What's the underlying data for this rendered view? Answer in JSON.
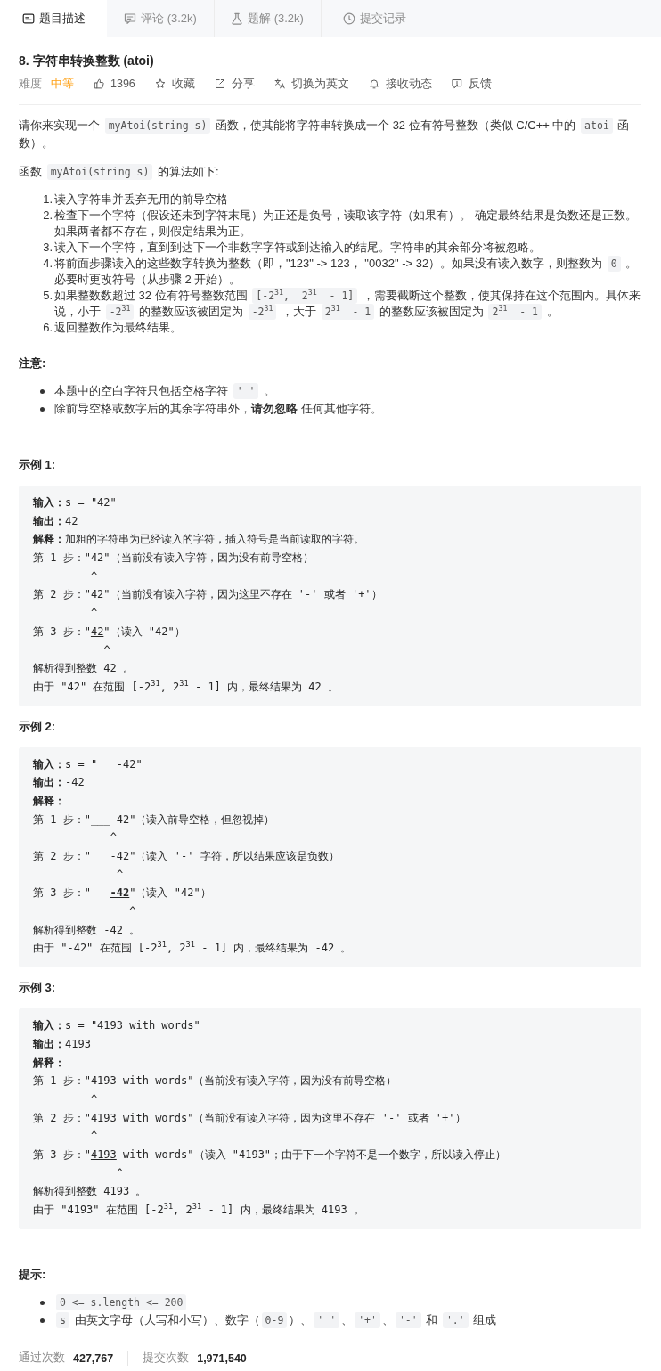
{
  "tabs": [
    {
      "kind": "description",
      "label": "题目描述",
      "selected": true
    },
    {
      "kind": "comments",
      "label": "评论 (3.2k)",
      "selected": false
    },
    {
      "kind": "solutions",
      "label": "题解 (3.2k)",
      "selected": false
    },
    {
      "kind": "submissions",
      "label": "提交记录",
      "selected": false
    }
  ],
  "problem": {
    "title": "8. 字符串转换整数 (atoi)",
    "difficulty": {
      "label": "难度",
      "value": "中等",
      "kind": "medium"
    },
    "actions": [
      {
        "kind": "like",
        "label": "1396"
      },
      {
        "kind": "favorite",
        "label": "收藏"
      },
      {
        "kind": "share",
        "label": "分享"
      },
      {
        "kind": "translate",
        "label": "切换为英文"
      },
      {
        "kind": "subscribe",
        "label": "接收动态"
      },
      {
        "kind": "feedback",
        "label": "反馈"
      }
    ]
  },
  "description": {
    "paragraphs": [
      [
        {
          "kind": "text",
          "text": "请你来实现一个 "
        },
        {
          "kind": "code",
          "text": "myAtoi(string s)"
        },
        {
          "kind": "text",
          "text": " 函数，使其能将字符串转换成一个 32 位有符号整数（类似 C/C++ 中的 "
        },
        {
          "kind": "code",
          "text": "atoi"
        },
        {
          "kind": "text",
          "text": " 函数）。"
        }
      ],
      [
        {
          "kind": "text",
          "text": "函数 "
        },
        {
          "kind": "code",
          "text": "myAtoi(string s)"
        },
        {
          "kind": "text",
          "text": " 的算法如下:"
        }
      ]
    ],
    "steps": [
      {
        "number": "1.",
        "segments": [
          {
            "kind": "text",
            "text": "读入字符串并丢弃无用的前导空格"
          }
        ]
      },
      {
        "number": "2.",
        "segments": [
          {
            "kind": "text",
            "text": "检查下一个字符（假设还未到字符末尾）为正还是负号，读取该字符（如果有）。 确定最终结果是负数还是正数。如果两者都不存在，则假定结果为正。"
          }
        ]
      },
      {
        "number": "3.",
        "segments": [
          {
            "kind": "text",
            "text": "读入下一个字符，直到到达下一个非数字字符或到达输入的结尾。字符串的其余部分将被忽略。"
          }
        ]
      },
      {
        "number": "4.",
        "segments": [
          {
            "kind": "text",
            "text": "将前面步骤读入的这些数字转换为整数（即，\"123\" -> 123， \"0032\" -> 32）。如果没有读入数字，则整数为 "
          },
          {
            "kind": "code",
            "text": "0"
          },
          {
            "kind": "text",
            "text": " 。必要时更改符号（从步骤 2 开始）。"
          }
        ]
      },
      {
        "number": "5.",
        "segments": [
          {
            "kind": "text",
            "text": "如果整数数超过 32 位有符号整数范围 "
          },
          {
            "kind": "code",
            "text": "[-2$^{31}$,  2$^{31}$  - 1]"
          },
          {
            "kind": "text",
            "text": " ，需要截断这个整数，使其保持在这个范围内。具体来说，小于 "
          },
          {
            "kind": "code",
            "text": "-2$^{31}$"
          },
          {
            "kind": "text",
            "text": " 的整数应该被固定为 "
          },
          {
            "kind": "code",
            "text": "-2$^{31}$"
          },
          {
            "kind": "text",
            "text": " ，大于 "
          },
          {
            "kind": "code",
            "text": "2$^{31}$  - 1"
          },
          {
            "kind": "text",
            "text": " 的整数应该被固定为 "
          },
          {
            "kind": "code",
            "text": "2$^{31}$  - 1"
          },
          {
            "kind": "text",
            "text": " 。"
          }
        ]
      },
      {
        "number": "6.",
        "segments": [
          {
            "kind": "text",
            "text": "返回整数作为最终结果。"
          }
        ]
      }
    ],
    "note": {
      "heading": "注意:",
      "items": [
        [
          {
            "kind": "text",
            "text": "本题中的空白字符只包括空格字符 "
          },
          {
            "kind": "code",
            "text": "' '"
          },
          {
            "kind": "text",
            "text": " 。"
          }
        ],
        [
          {
            "kind": "text",
            "text": "除前导空格或数字后的其余字符串外，**请勿忽略** 任何其他字符。"
          }
        ]
      ]
    }
  },
  "examples": [
    {
      "heading": "示例 1:",
      "lines": [
        [
          {
            "kind": "label",
            "text": "输入："
          },
          {
            "kind": "plain",
            "text": "s = \"42\""
          }
        ],
        [
          {
            "kind": "label",
            "text": "输出："
          },
          {
            "kind": "plain",
            "text": "42"
          }
        ],
        [
          {
            "kind": "label",
            "text": "解释："
          },
          {
            "kind": "plain",
            "text": "加粗的字符串为已经读入的字符，插入符号是当前读取的字符。"
          }
        ],
        [
          {
            "kind": "plain",
            "text": "第 1 步：\"42\"（当前没有读入字符，因为没有前导空格）"
          }
        ],
        [
          {
            "kind": "plain",
            "text": "         ^"
          }
        ],
        [
          {
            "kind": "plain",
            "text": "第 2 步：\"42\"（当前没有读入字符，因为这里不存在 '-' 或者 '+'）"
          }
        ],
        [
          {
            "kind": "plain",
            "text": "         ^"
          }
        ],
        [
          {
            "kind": "plain",
            "text": "第 3 步：\""
          },
          {
            "kind": "read",
            "text": "42"
          },
          {
            "kind": "plain",
            "text": "\"（读入 \"42\"）"
          }
        ],
        [
          {
            "kind": "plain",
            "text": "           ^"
          }
        ],
        [
          {
            "kind": "plain",
            "text": "解析得到整数 42 。"
          }
        ],
        [
          {
            "kind": "plain",
            "text": "由于 \"42\" 在范围 [-2$^{31}$, 2$^{31}$ - 1] 内，最终结果为 42 。"
          }
        ]
      ]
    },
    {
      "heading": "示例 2:",
      "lines": [
        [
          {
            "kind": "label",
            "text": "输入："
          },
          {
            "kind": "plain",
            "text": "s = \"   -42\""
          }
        ],
        [
          {
            "kind": "label",
            "text": "输出："
          },
          {
            "kind": "plain",
            "text": "-42"
          }
        ],
        [
          {
            "kind": "label",
            "text": "解释："
          }
        ],
        [
          {
            "kind": "plain",
            "text": "第 1 步：\"___-42\"（读入前导空格，但忽视掉）"
          }
        ],
        [
          {
            "kind": "plain",
            "text": "            ^"
          }
        ],
        [
          {
            "kind": "plain",
            "text": "第 2 步：\"   "
          },
          {
            "kind": "read",
            "text": "-"
          },
          {
            "kind": "plain",
            "text": "42\"（读入 '-' 字符，所以结果应该是负数）"
          }
        ],
        [
          {
            "kind": "plain",
            "text": "             ^"
          }
        ],
        [
          {
            "kind": "plain",
            "text": "第 3 步：\"   "
          },
          {
            "kind": "readbold",
            "text": "-42"
          },
          {
            "kind": "plain",
            "text": "\"（读入 \"42\"）"
          }
        ],
        [
          {
            "kind": "plain",
            "text": "               ^"
          }
        ],
        [
          {
            "kind": "plain",
            "text": "解析得到整数 -42 。"
          }
        ],
        [
          {
            "kind": "plain",
            "text": "由于 \"-42\" 在范围 [-2$^{31}$, 2$^{31}$ - 1] 内，最终结果为 -42 。"
          }
        ]
      ]
    },
    {
      "heading": "示例 3:",
      "lines": [
        [
          {
            "kind": "label",
            "text": "输入："
          },
          {
            "kind": "plain",
            "text": "s = \"4193 with words\""
          }
        ],
        [
          {
            "kind": "label",
            "text": "输出："
          },
          {
            "kind": "plain",
            "text": "4193"
          }
        ],
        [
          {
            "kind": "label",
            "text": "解释："
          }
        ],
        [
          {
            "kind": "plain",
            "text": "第 1 步：\"4193 with words\"（当前没有读入字符，因为没有前导空格）"
          }
        ],
        [
          {
            "kind": "plain",
            "text": "         ^"
          }
        ],
        [
          {
            "kind": "plain",
            "text": "第 2 步：\"4193 with words\"（当前没有读入字符，因为这里不存在 '-' 或者 '+'）"
          }
        ],
        [
          {
            "kind": "plain",
            "text": "         ^"
          }
        ],
        [
          {
            "kind": "plain",
            "text": "第 3 步：\""
          },
          {
            "kind": "read",
            "text": "4193"
          },
          {
            "kind": "plain",
            "text": " with words\"（读入 \"4193\"；由于下一个字符不是一个数字，所以读入停止）"
          }
        ],
        [
          {
            "kind": "plain",
            "text": "             ^"
          }
        ],
        [
          {
            "kind": "plain",
            "text": "解析得到整数 4193 。"
          }
        ],
        [
          {
            "kind": "plain",
            "text": "由于 \"4193\" 在范围 [-2$^{31}$, 2$^{31}$ - 1] 内，最终结果为 4193 。"
          }
        ]
      ]
    }
  ],
  "hints": {
    "heading": "提示:",
    "items": [
      [
        {
          "kind": "code",
          "text": "0 <= s.length <= 200"
        }
      ],
      [
        {
          "kind": "code",
          "text": "s"
        },
        {
          "kind": "text",
          "text": " 由英文字母（大写和小写）、数字（"
        },
        {
          "kind": "code",
          "text": "0-9"
        },
        {
          "kind": "text",
          "text": "）、"
        },
        {
          "kind": "code",
          "text": "' '"
        },
        {
          "kind": "text",
          "text": "、"
        },
        {
          "kind": "code",
          "text": "'+'"
        },
        {
          "kind": "text",
          "text": "、"
        },
        {
          "kind": "code",
          "text": "'-'"
        },
        {
          "kind": "text",
          "text": " 和 "
        },
        {
          "kind": "code",
          "text": "'.'"
        },
        {
          "kind": "text",
          "text": " 组成"
        }
      ]
    ]
  },
  "stats": [
    {
      "label": "通过次数",
      "value": "427,767"
    },
    {
      "label": "提交次数",
      "value": "1,971,540"
    }
  ]
}
